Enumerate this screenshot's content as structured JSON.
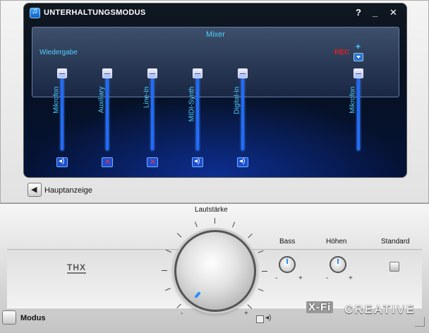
{
  "window": {
    "title": "UNTERHALTUNGSMODUS",
    "help": "?",
    "minimize": "_",
    "close": "✕"
  },
  "mixer": {
    "title": "Mixer",
    "section_label": "Wiedergabe",
    "rec_label": "REC",
    "rec_plus": "+",
    "channels": [
      {
        "label": "Mikrofon",
        "muted": false
      },
      {
        "label": "Auxiliary",
        "muted": true
      },
      {
        "label": "Line-In",
        "muted": true
      },
      {
        "label": "MIDI-Synth",
        "muted": false
      },
      {
        "label": "Digital-In",
        "muted": false
      }
    ],
    "rec_channel": {
      "label": "Mikrofon"
    }
  },
  "nav": {
    "back_label": "Hauptanzeige"
  },
  "controls": {
    "volume_label": "Lautstärke",
    "bass_label": "Bass",
    "treble_label": "Höhen",
    "standard_label": "Standard",
    "minus": "-",
    "plus": "+"
  },
  "brand": {
    "thx": "THX",
    "xfi": "X-Fi",
    "creative": "CREATIVE"
  },
  "footer": {
    "mode_label": "Modus"
  },
  "colors": {
    "accent": "#4fd0ff",
    "rec": "#e02020",
    "slider": "#1f6cff"
  }
}
